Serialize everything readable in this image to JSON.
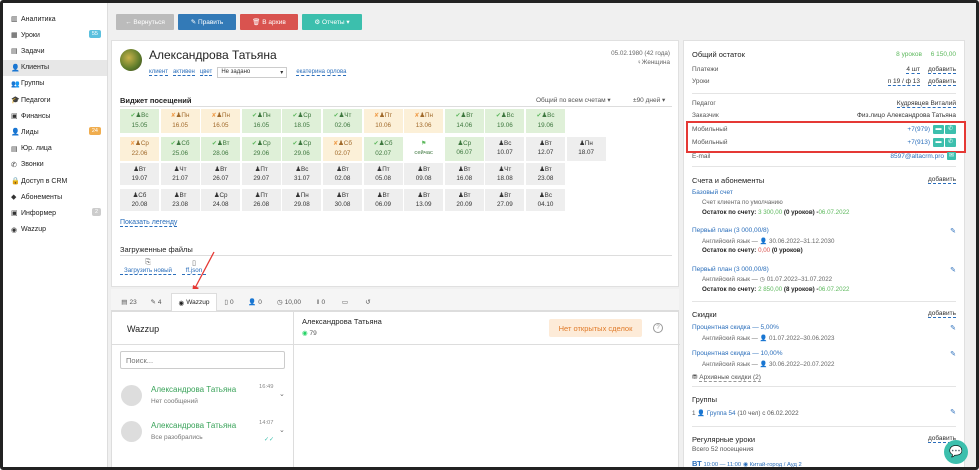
{
  "sidebar": {
    "items": [
      {
        "label": "Аналитика",
        "icon": "bar-chart-icon",
        "glyph": "▥"
      },
      {
        "label": "Уроки",
        "icon": "calendar-icon",
        "glyph": "▦",
        "badge": "55",
        "badge_color": "#5bc0de"
      },
      {
        "label": "Задачи",
        "icon": "tasks-icon",
        "glyph": "▤"
      },
      {
        "label": "Клиенты",
        "icon": "user-icon",
        "glyph": "👤",
        "active": true
      },
      {
        "label": "Группы",
        "icon": "users-icon",
        "glyph": "👥"
      },
      {
        "label": "Педагоги",
        "icon": "graduation-cap-icon",
        "glyph": "🎓"
      },
      {
        "label": "Финансы",
        "icon": "money-icon",
        "glyph": "▣"
      },
      {
        "label": "Лиды",
        "icon": "lead-icon",
        "glyph": "👤",
        "badge": "24",
        "badge_color": "#f0ad4e"
      },
      {
        "label": "Юр. лица",
        "icon": "legal-icon",
        "glyph": "▤"
      },
      {
        "label": "Звонки",
        "icon": "phone-icon",
        "glyph": "✆"
      },
      {
        "label": "Доступ в CRM",
        "icon": "lock-icon",
        "glyph": "🔒"
      },
      {
        "label": "Абонементы",
        "icon": "tag-icon",
        "glyph": "◆"
      },
      {
        "label": "Информер",
        "icon": "informer-icon",
        "glyph": "▣",
        "badge": "2",
        "badge_color": "#ccc"
      },
      {
        "label": "Wazzup",
        "icon": "whatsapp-icon",
        "glyph": "◉"
      }
    ]
  },
  "toolbar": {
    "back": "← Вернуться",
    "edit": "✎ Править",
    "archive": "🗑 В архив",
    "reports": "⚙ Отчеты ▾",
    "colors": {
      "back": "#bbbbbb",
      "edit": "#337ab7",
      "archive": "#d9534f",
      "reports": "#3cbfad"
    }
  },
  "client": {
    "name": "Александрова Татьяна",
    "birthdate": "05.02.1980 (42 года)",
    "gender": "Женщина",
    "tags": [
      "клиент",
      "активен",
      "цвет"
    ],
    "status_select": "Не задано",
    "owner": "екатерина орлова"
  },
  "visits": {
    "title": "Виджет посещений",
    "filter": "Общий по всем счетам ▾",
    "period": "±90 дней ▾",
    "rows": [
      [
        [
          "Вс",
          "15.05",
          "g",
          "✔"
        ],
        [
          "Пн",
          "16.05",
          "o",
          "✘"
        ],
        [
          "Пн",
          "16.05",
          "o",
          "✘"
        ],
        [
          "Пн",
          "16.05",
          "g",
          "✔"
        ],
        [
          "Ср",
          "18.05",
          "g",
          "✔"
        ],
        [
          "Чт",
          "02.06",
          "g",
          "✔"
        ],
        [
          "Пт",
          "10.06",
          "o",
          "✘"
        ],
        [
          "Пн",
          "13.06",
          "o",
          "✘"
        ],
        [
          "Вт",
          "14.06",
          "g",
          "✔"
        ],
        [
          "Вс",
          "19.06",
          "g",
          "✔"
        ],
        [
          "Вс",
          "19.06",
          "g",
          "✔"
        ]
      ],
      [
        [
          "Ср",
          "22.06",
          "o",
          "✘"
        ],
        [
          "Сб",
          "25.06",
          "g",
          "✔"
        ],
        [
          "Вт",
          "28.06",
          "g",
          "✔"
        ],
        [
          "Ср",
          "29.06",
          "g",
          "✔"
        ],
        [
          "Ср",
          "29.06",
          "g",
          "✔"
        ],
        [
          "Сб",
          "02.07",
          "o",
          "✘"
        ],
        [
          "Сб",
          "02.07",
          "g",
          "✔"
        ],
        [
          "",
          "сейчас",
          "w",
          "⚑"
        ],
        [
          "Ср",
          "06.07",
          "g",
          ""
        ],
        [
          "Вс",
          "10.07",
          "n",
          ""
        ],
        [
          "Вт",
          "12.07",
          "n",
          ""
        ],
        [
          "Пн",
          "18.07",
          "n",
          ""
        ]
      ],
      [
        [
          "Вт",
          "19.07",
          "n",
          ""
        ],
        [
          "Чт",
          "21.07",
          "n",
          ""
        ],
        [
          "Вт",
          "26.07",
          "n",
          ""
        ],
        [
          "Пт",
          "29.07",
          "n",
          ""
        ],
        [
          "Вс",
          "31.07",
          "n",
          ""
        ],
        [
          "Вт",
          "02.08",
          "n",
          ""
        ],
        [
          "Пт",
          "05.08",
          "n",
          ""
        ],
        [
          "Вт",
          "09.08",
          "n",
          ""
        ],
        [
          "Вт",
          "16.08",
          "n",
          ""
        ],
        [
          "Чт",
          "18.08",
          "n",
          ""
        ],
        [
          "Вт",
          "23.08",
          "n",
          ""
        ]
      ],
      [
        [
          "Сб",
          "20.08",
          "n",
          ""
        ],
        [
          "Вт",
          "23.08",
          "n",
          ""
        ],
        [
          "Ср",
          "24.08",
          "n",
          ""
        ],
        [
          "Пт",
          "26.08",
          "n",
          ""
        ],
        [
          "Пн",
          "29.08",
          "n",
          ""
        ],
        [
          "Вт",
          "30.08",
          "n",
          ""
        ],
        [
          "Вт",
          "06.09",
          "n",
          ""
        ],
        [
          "Вт",
          "13.09",
          "n",
          ""
        ],
        [
          "Вт",
          "20.09",
          "n",
          ""
        ],
        [
          "Вт",
          "27.09",
          "n",
          ""
        ],
        [
          "Вс",
          "04.10",
          "n",
          ""
        ]
      ]
    ],
    "legend_link": "Показать легенду"
  },
  "files": {
    "title": "Загруженные файлы",
    "upload": "Загрузить новый",
    "file": "ff.json"
  },
  "tabs": [
    {
      "icon": "list-icon",
      "glyph": "▤",
      "label": "23"
    },
    {
      "icon": "comment-icon",
      "glyph": "✎",
      "label": "4"
    },
    {
      "icon": "whatsapp-icon",
      "glyph": "◉",
      "label": "Wazzup",
      "active": true
    },
    {
      "icon": "doc-icon",
      "glyph": "▯",
      "label": "0"
    },
    {
      "icon": "user-icon",
      "glyph": "👤",
      "label": "0"
    },
    {
      "icon": "clock-icon",
      "glyph": "◷",
      "label": "10,00"
    },
    {
      "icon": "pause-icon",
      "glyph": "‖",
      "label": "0"
    },
    {
      "icon": "money-icon",
      "glyph": "▭",
      "label": ""
    },
    {
      "icon": "history-icon",
      "glyph": "↺",
      "label": ""
    }
  ],
  "wazzup": {
    "title": "Wazzup",
    "search_placeholder": "Поиск...",
    "chats": [
      {
        "name": "Александрова Татьяна",
        "time": "16:49",
        "preview": "Нет сообщений",
        "ticks": ""
      },
      {
        "name": "Александрова Татьяна",
        "time": "14:07",
        "preview": "Все разобрались",
        "ticks": "✓✓"
      }
    ],
    "header_name": "Александрова Татьяна",
    "header_sub": "79",
    "no_deals": "Нет открытых сделок",
    "help": "?"
  },
  "right": {
    "balance": {
      "title": "Общий остаток",
      "lessons": "8 уроков",
      "amount": "6 150,00"
    },
    "payments": {
      "label": "Платежи",
      "count": "4 шт",
      "add": "добавить"
    },
    "lessons": {
      "label": "Уроки",
      "count": "п 19 / ф 13",
      "add": "добавить"
    },
    "teacher": {
      "label": "Педагог",
      "value": "Кудрявцев Виталий"
    },
    "customer": {
      "label": "Заказчик",
      "value": "Физ.лицо Александрова Татьяна"
    },
    "phones": [
      {
        "label": "Мобильный",
        "value": "+7(979)"
      },
      {
        "label": "Мобильный",
        "value": "+7(913)"
      }
    ],
    "email": {
      "label": "E-mail",
      "value": "8597@altacrm.pro"
    },
    "accounts": {
      "title": "Счета и абонементы",
      "add": "добавить",
      "items": [
        {
          "title": "Базовый счет",
          "line1": "Счет клиента по умолчанию",
          "balance_label": "Остаток по счету:",
          "balance": "3 300,00",
          "rest": "(0 уроков) -",
          "date": "06.07.2022",
          "date_color": "#5cb85c"
        },
        {
          "title": "Первый план (3 000,00/8)",
          "line1": "Английский язык — 👤 30.06.2022–31.12.2030",
          "balance_label": "Остаток по счету:",
          "balance": "0,00",
          "rest": "(0 уроков)",
          "date": "",
          "date_color": "#d9534f"
        },
        {
          "title": "Первый план (3 000,00/8)",
          "line1": "Английский язык — ◷ 01.07.2022–31.07.2022",
          "balance_label": "Остаток по счету:",
          "balance": "2 850,00",
          "rest": "(8 уроков) -",
          "date": "06.07.2022",
          "date_color": "#5cb85c"
        }
      ]
    },
    "discounts": {
      "title": "Скидки",
      "add": "добавить",
      "items": [
        {
          "title": "Процентная скидка — 5,00%",
          "line1": "Английский язык — 👤 01.07.2022–30.06.2023"
        },
        {
          "title": "Процентная скидка — 10,00%",
          "line1": "Английский язык — 👤 30.06.2022–20.07.2022"
        }
      ],
      "archive": "Архивные скидки (2)"
    },
    "groups": {
      "title": "Группы",
      "prefix": "1 👤",
      "item": "Группа 54",
      "suffix": "(10 чел) с 06.02.2022"
    },
    "regular": {
      "title": "Регулярные уроки",
      "add": "добавить",
      "count": "Всего 52 посещения",
      "day": "ВТ",
      "time": "10:00 — 11:00",
      "place": "◉ Китай-город / Ауд 2"
    }
  },
  "highlight_color": "#e53935",
  "chat_fab_color": "#3cbfad"
}
